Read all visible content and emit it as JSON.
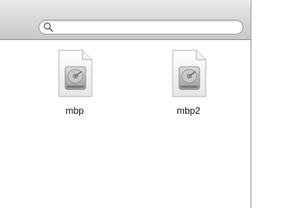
{
  "search": {
    "placeholder": "",
    "value": "",
    "icon": "search-icon"
  },
  "files": [
    {
      "name": "mbp",
      "icon": "disk-image-icon"
    },
    {
      "name": "mbp2",
      "icon": "disk-image-icon"
    }
  ],
  "colors": {
    "toolbar_top": "#e9e9e9",
    "toolbar_bottom": "#c8c8c8",
    "window_border": "#9b9b9b"
  }
}
